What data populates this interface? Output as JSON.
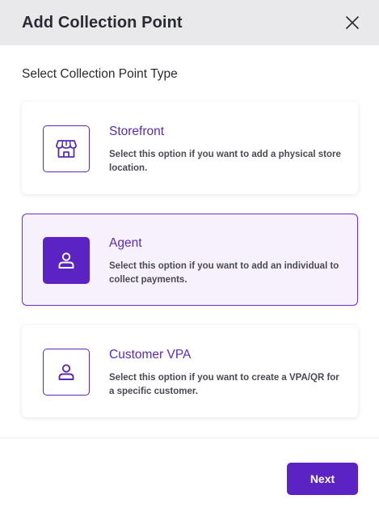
{
  "header": {
    "title": "Add Collection Point",
    "close_icon": "close-icon"
  },
  "body": {
    "section_title": "Select Collection Point Type"
  },
  "options": [
    {
      "title": "Storefront",
      "description": "Select this option if you want to add a physical store location.",
      "icon": "storefront-icon",
      "selected": false
    },
    {
      "title": "Agent",
      "description": "Select this option if you want to add an individual to collect payments.",
      "icon": "person-icon",
      "selected": true
    },
    {
      "title": "Customer VPA",
      "description": "Select this option if you want to create a VPA/QR for a specific customer.",
      "icon": "person-icon",
      "selected": false
    }
  ],
  "footer": {
    "next_label": "Next"
  },
  "colors": {
    "accent": "#5b22c4",
    "header_bg": "#e9e9ec",
    "selected_bg": "#f6f1fd"
  }
}
